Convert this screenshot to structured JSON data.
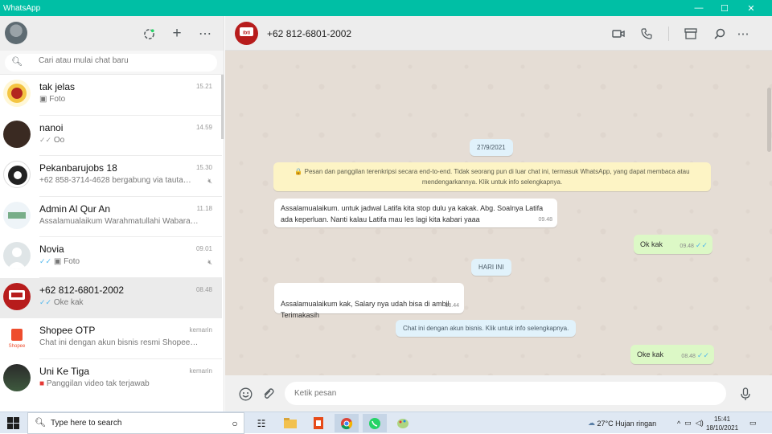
{
  "window": {
    "title": "WhatsApp",
    "controls": {
      "minimize": "—",
      "maximize": "☐",
      "close": "✕"
    }
  },
  "sidebar": {
    "search_placeholder": "Cari atau mulai chat baru",
    "chats": [
      {
        "name": "tak jelas",
        "time": "15.21",
        "preview": "Foto",
        "preview_icon": "photo-icon",
        "ticks": "",
        "muted": false,
        "avatar_color": "#f4d24a"
      },
      {
        "name": "nanoi",
        "time": "14.59",
        "preview": "Oo",
        "ticks": "✓✓",
        "tick_color": "grey",
        "muted": false,
        "avatar_color": "#3a2a22"
      },
      {
        "name": "Pekanbarujobs 18",
        "time": "15.30",
        "preview": "+62 858-3714-4628 bergabung via tautan u...",
        "ticks": "",
        "muted": true,
        "avatar_color": "#222222"
      },
      {
        "name": "Admin Al Qur An",
        "time": "11.18",
        "preview": "Assalamualaikum Warahmatullahi Wabarakatuh....",
        "ticks": "",
        "muted": false,
        "avatar_color": "#e9f1f7"
      },
      {
        "name": "Novia",
        "time": "09.01",
        "preview": "Foto",
        "preview_icon": "photo-icon",
        "ticks": "✓✓",
        "tick_color": "blue",
        "muted": true,
        "avatar_color": "#dfe5e7"
      },
      {
        "name": "+62 812-6801-2002",
        "time": "08.48",
        "preview": "Oke kak",
        "ticks": "✓✓",
        "tick_color": "blue",
        "muted": false,
        "active": true,
        "avatar_color": "#b71c1c"
      },
      {
        "name": "Shopee OTP",
        "time": "kemarin",
        "preview": "Chat ini dengan akun bisnis resmi Shopee OTP....",
        "ticks": "",
        "muted": false,
        "avatar_color": "#ee4d2d"
      },
      {
        "name": "Uni Ke Tiga",
        "time": "kemarin",
        "preview": "Panggilan video tak terjawab",
        "preview_icon": "missed-video-icon",
        "ticks": "",
        "muted": false,
        "avatar_color": "#2e3b2e"
      }
    ]
  },
  "conversation": {
    "contact_name": "+62 812-6801-2002",
    "date_pill": "27/9/2021",
    "encryption_notice": "🔒 Pesan dan panggilan terenkripsi secara end-to-end. Tidak seorang pun di luar chat ini, termasuk WhatsApp, yang dapat membaca atau mendengarkannya. Klik untuk info selengkapnya.",
    "messages": [
      {
        "dir": "in",
        "text": "Assalamualaikum. untuk jadwal Latifa kita stop dulu ya kakak. Abg. Soalnya Latifa ada keperluan. Nanti kalau Latifa mau les lagi kita kabari yaaa",
        "time": "09.48"
      },
      {
        "dir": "out",
        "text": "Ok kak",
        "time": "09.48",
        "ticks": "✓✓"
      },
      {
        "dir": "in",
        "text": "Assalamualaikum kak, Salary nya udah bisa di ambil\nTerimakasih",
        "time": "08.44"
      },
      {
        "dir": "out",
        "text": "Oke kak",
        "time": "08.48",
        "ticks": "✓✓"
      }
    ],
    "today_pill": "HARI INI",
    "business_notice": "Chat ini dengan akun bisnis. Klik untuk info selengkapnya.",
    "composer_placeholder": "Ketik pesan"
  },
  "taskbar": {
    "search_text": "Type here to search",
    "weather": "27°C  Hujan ringan",
    "time": "15:41",
    "date": "18/10/2021"
  }
}
